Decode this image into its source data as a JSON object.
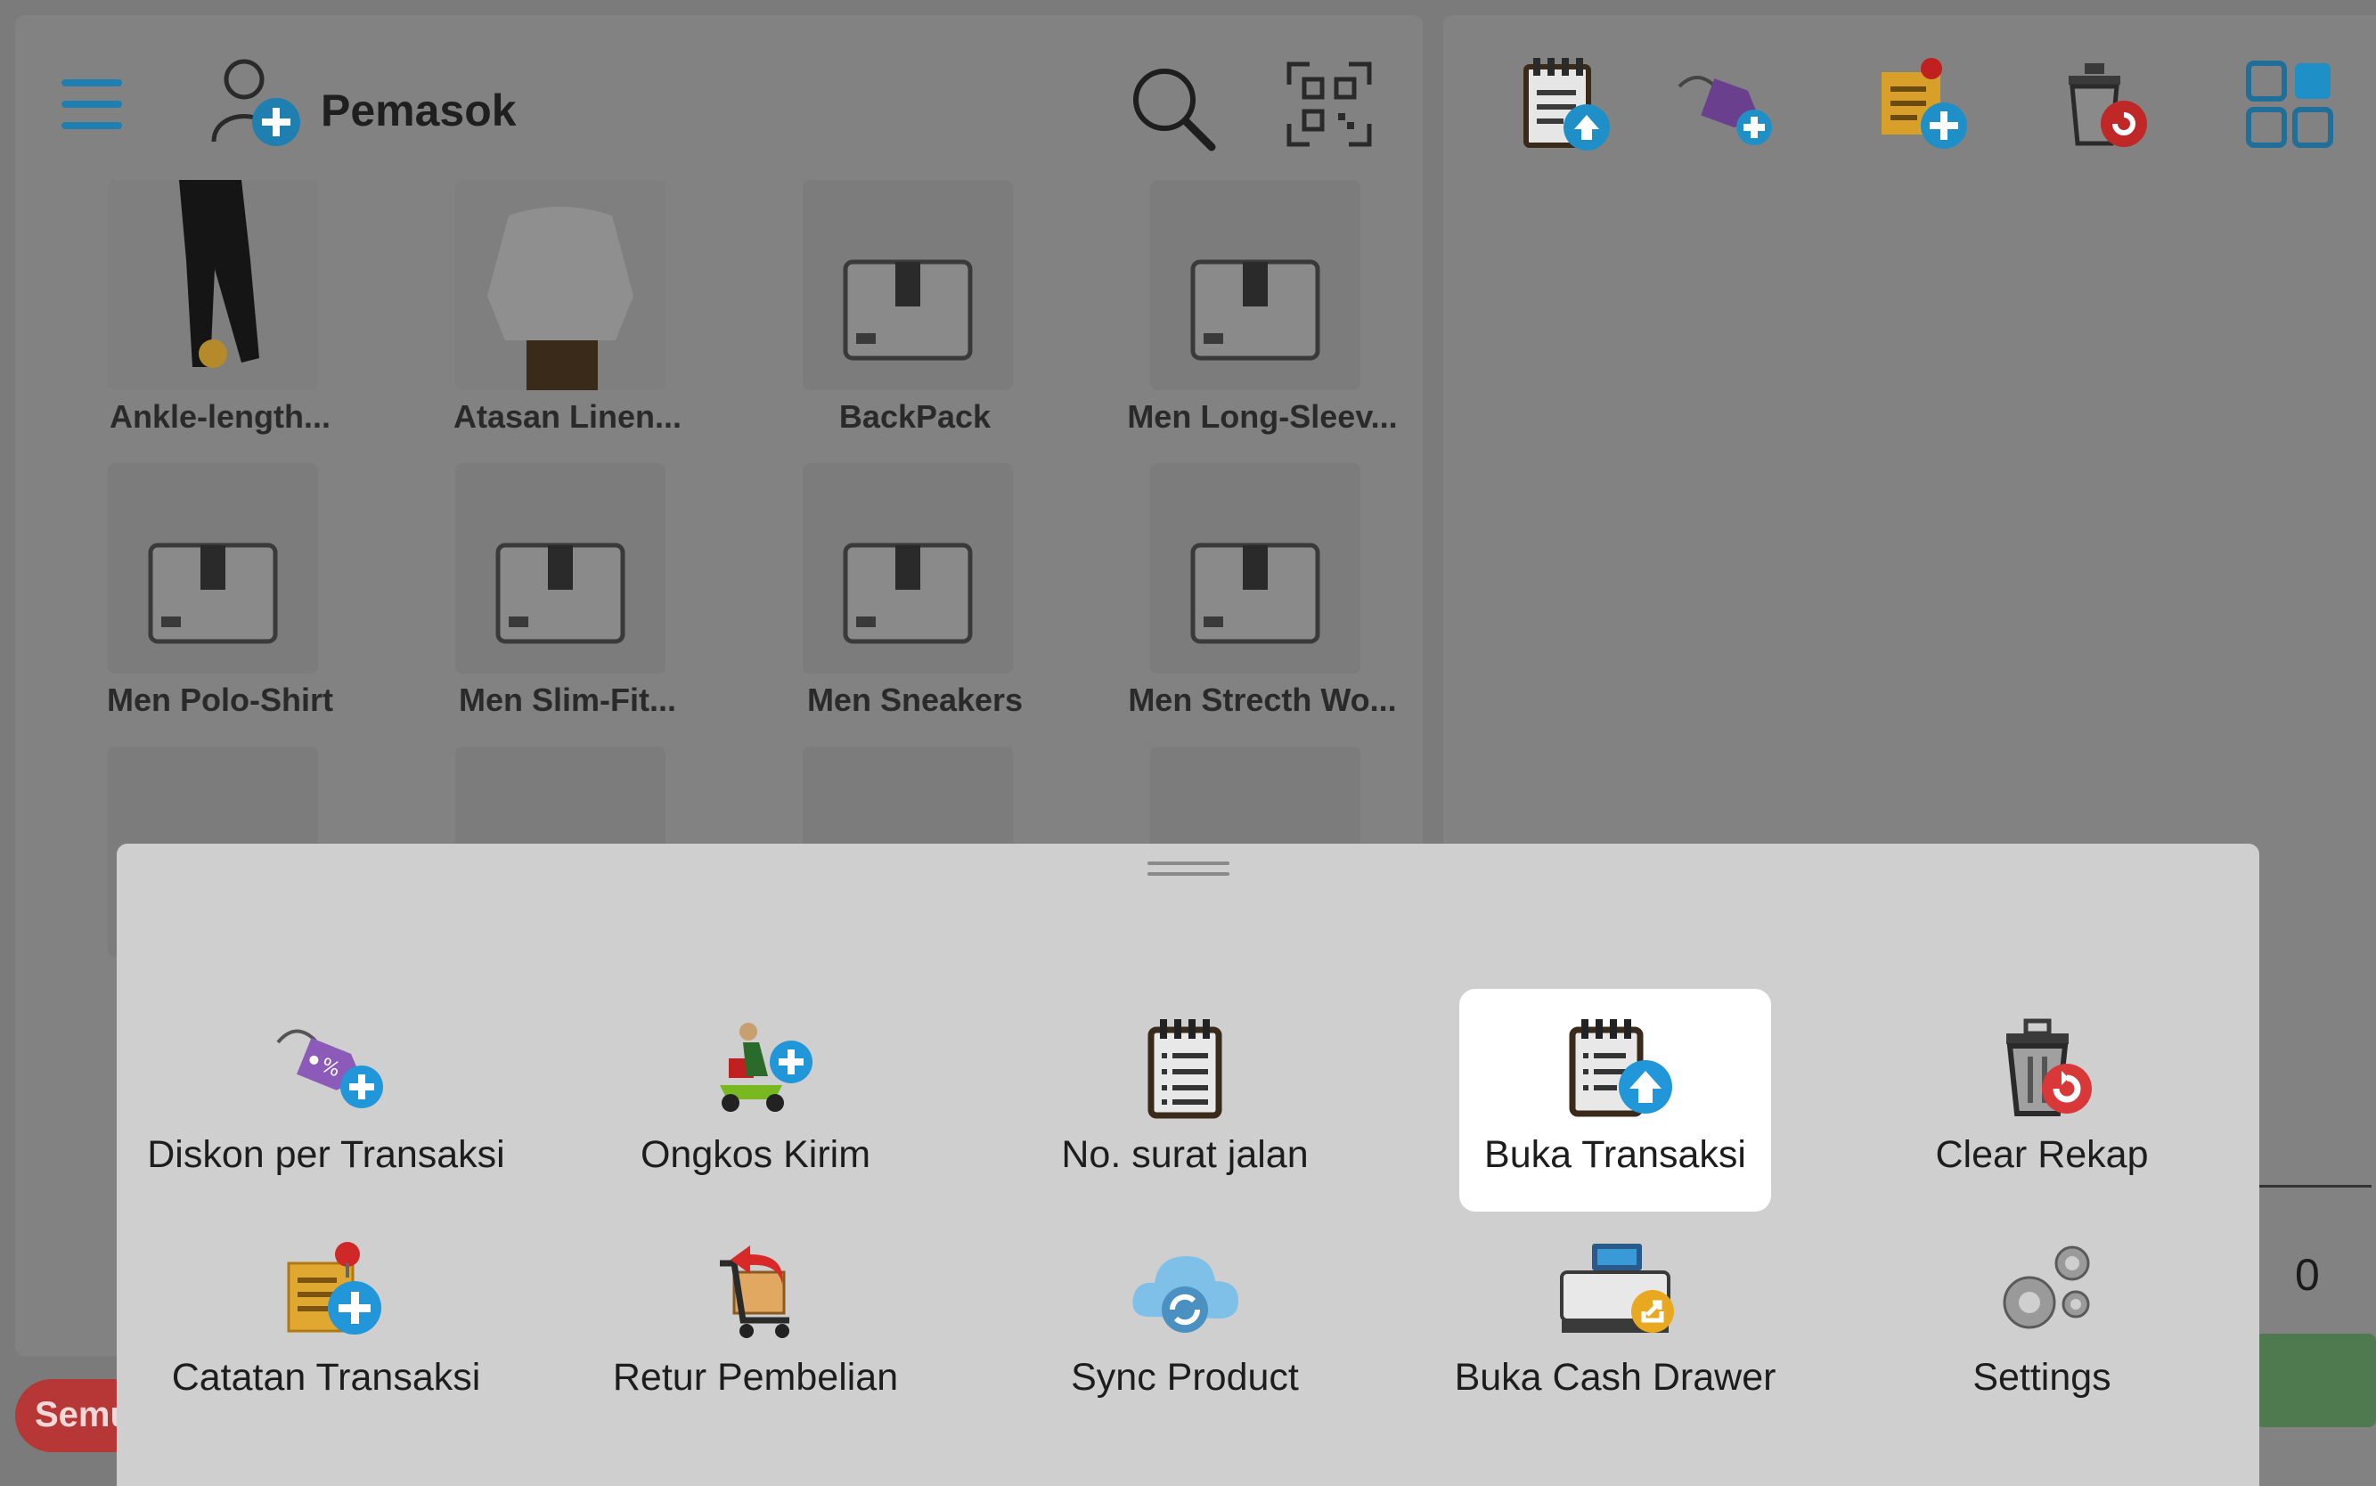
{
  "header": {
    "title": "Pemasok"
  },
  "products": [
    {
      "name": "Ankle-length..."
    },
    {
      "name": "Atasan Linen..."
    },
    {
      "name": "BackPack"
    },
    {
      "name": "Men Long-Sleev..."
    },
    {
      "name": "Men Polo-Shirt"
    },
    {
      "name": "Men Slim-Fit..."
    },
    {
      "name": "Men Sneakers"
    },
    {
      "name": "Men Strecth Wo..."
    }
  ],
  "right_panel": {
    "total_value": "0"
  },
  "category_chip": {
    "label": "Semu"
  },
  "menu": {
    "items": [
      {
        "label": "Diskon per Transaksi",
        "icon": "discount-tag-add-icon"
      },
      {
        "label": "Ongkos Kirim",
        "icon": "delivery-scooter-add-icon"
      },
      {
        "label": "No. surat jalan",
        "icon": "notepad-icon"
      },
      {
        "label": "Buka Transaksi",
        "icon": "notepad-upload-icon",
        "selected": true
      },
      {
        "label": "Clear Rekap",
        "icon": "trash-reset-icon"
      },
      {
        "label": "Catatan Transaksi",
        "icon": "note-add-icon"
      },
      {
        "label": "Retur Pembelian",
        "icon": "cart-return-icon"
      },
      {
        "label": "Sync Product",
        "icon": "cloud-sync-icon"
      },
      {
        "label": "Buka Cash Drawer",
        "icon": "cash-drawer-icon"
      },
      {
        "label": "Settings",
        "icon": "gears-icon"
      }
    ]
  },
  "colors": {
    "accent_blue": "#1f7fb0",
    "sheet_bg": "#cfcfcf",
    "selected_bg": "#ffffff",
    "chip_red": "#b73636"
  }
}
